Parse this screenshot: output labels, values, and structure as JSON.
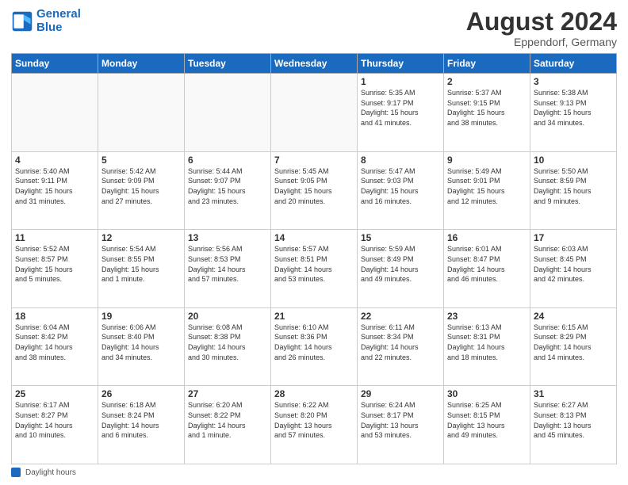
{
  "header": {
    "logo_line1": "General",
    "logo_line2": "Blue",
    "month_year": "August 2024",
    "location": "Eppendorf, Germany"
  },
  "days_of_week": [
    "Sunday",
    "Monday",
    "Tuesday",
    "Wednesday",
    "Thursday",
    "Friday",
    "Saturday"
  ],
  "footer_label": "Daylight hours",
  "weeks": [
    [
      {
        "day": "",
        "info": ""
      },
      {
        "day": "",
        "info": ""
      },
      {
        "day": "",
        "info": ""
      },
      {
        "day": "",
        "info": ""
      },
      {
        "day": "1",
        "info": "Sunrise: 5:35 AM\nSunset: 9:17 PM\nDaylight: 15 hours\nand 41 minutes."
      },
      {
        "day": "2",
        "info": "Sunrise: 5:37 AM\nSunset: 9:15 PM\nDaylight: 15 hours\nand 38 minutes."
      },
      {
        "day": "3",
        "info": "Sunrise: 5:38 AM\nSunset: 9:13 PM\nDaylight: 15 hours\nand 34 minutes."
      }
    ],
    [
      {
        "day": "4",
        "info": "Sunrise: 5:40 AM\nSunset: 9:11 PM\nDaylight: 15 hours\nand 31 minutes."
      },
      {
        "day": "5",
        "info": "Sunrise: 5:42 AM\nSunset: 9:09 PM\nDaylight: 15 hours\nand 27 minutes."
      },
      {
        "day": "6",
        "info": "Sunrise: 5:44 AM\nSunset: 9:07 PM\nDaylight: 15 hours\nand 23 minutes."
      },
      {
        "day": "7",
        "info": "Sunrise: 5:45 AM\nSunset: 9:05 PM\nDaylight: 15 hours\nand 20 minutes."
      },
      {
        "day": "8",
        "info": "Sunrise: 5:47 AM\nSunset: 9:03 PM\nDaylight: 15 hours\nand 16 minutes."
      },
      {
        "day": "9",
        "info": "Sunrise: 5:49 AM\nSunset: 9:01 PM\nDaylight: 15 hours\nand 12 minutes."
      },
      {
        "day": "10",
        "info": "Sunrise: 5:50 AM\nSunset: 8:59 PM\nDaylight: 15 hours\nand 9 minutes."
      }
    ],
    [
      {
        "day": "11",
        "info": "Sunrise: 5:52 AM\nSunset: 8:57 PM\nDaylight: 15 hours\nand 5 minutes."
      },
      {
        "day": "12",
        "info": "Sunrise: 5:54 AM\nSunset: 8:55 PM\nDaylight: 15 hours\nand 1 minute."
      },
      {
        "day": "13",
        "info": "Sunrise: 5:56 AM\nSunset: 8:53 PM\nDaylight: 14 hours\nand 57 minutes."
      },
      {
        "day": "14",
        "info": "Sunrise: 5:57 AM\nSunset: 8:51 PM\nDaylight: 14 hours\nand 53 minutes."
      },
      {
        "day": "15",
        "info": "Sunrise: 5:59 AM\nSunset: 8:49 PM\nDaylight: 14 hours\nand 49 minutes."
      },
      {
        "day": "16",
        "info": "Sunrise: 6:01 AM\nSunset: 8:47 PM\nDaylight: 14 hours\nand 46 minutes."
      },
      {
        "day": "17",
        "info": "Sunrise: 6:03 AM\nSunset: 8:45 PM\nDaylight: 14 hours\nand 42 minutes."
      }
    ],
    [
      {
        "day": "18",
        "info": "Sunrise: 6:04 AM\nSunset: 8:42 PM\nDaylight: 14 hours\nand 38 minutes."
      },
      {
        "day": "19",
        "info": "Sunrise: 6:06 AM\nSunset: 8:40 PM\nDaylight: 14 hours\nand 34 minutes."
      },
      {
        "day": "20",
        "info": "Sunrise: 6:08 AM\nSunset: 8:38 PM\nDaylight: 14 hours\nand 30 minutes."
      },
      {
        "day": "21",
        "info": "Sunrise: 6:10 AM\nSunset: 8:36 PM\nDaylight: 14 hours\nand 26 minutes."
      },
      {
        "day": "22",
        "info": "Sunrise: 6:11 AM\nSunset: 8:34 PM\nDaylight: 14 hours\nand 22 minutes."
      },
      {
        "day": "23",
        "info": "Sunrise: 6:13 AM\nSunset: 8:31 PM\nDaylight: 14 hours\nand 18 minutes."
      },
      {
        "day": "24",
        "info": "Sunrise: 6:15 AM\nSunset: 8:29 PM\nDaylight: 14 hours\nand 14 minutes."
      }
    ],
    [
      {
        "day": "25",
        "info": "Sunrise: 6:17 AM\nSunset: 8:27 PM\nDaylight: 14 hours\nand 10 minutes."
      },
      {
        "day": "26",
        "info": "Sunrise: 6:18 AM\nSunset: 8:24 PM\nDaylight: 14 hours\nand 6 minutes."
      },
      {
        "day": "27",
        "info": "Sunrise: 6:20 AM\nSunset: 8:22 PM\nDaylight: 14 hours\nand 1 minute."
      },
      {
        "day": "28",
        "info": "Sunrise: 6:22 AM\nSunset: 8:20 PM\nDaylight: 13 hours\nand 57 minutes."
      },
      {
        "day": "29",
        "info": "Sunrise: 6:24 AM\nSunset: 8:17 PM\nDaylight: 13 hours\nand 53 minutes."
      },
      {
        "day": "30",
        "info": "Sunrise: 6:25 AM\nSunset: 8:15 PM\nDaylight: 13 hours\nand 49 minutes."
      },
      {
        "day": "31",
        "info": "Sunrise: 6:27 AM\nSunset: 8:13 PM\nDaylight: 13 hours\nand 45 minutes."
      }
    ]
  ]
}
